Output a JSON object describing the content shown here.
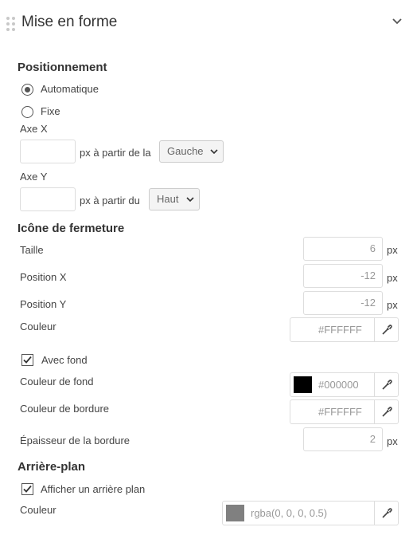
{
  "header": {
    "title": "Mise en forme"
  },
  "positionnement": {
    "title": "Positionnement",
    "option_auto": "Automatique",
    "option_fixe": "Fixe",
    "selected": "Automatique",
    "axe_x_label": "Axe X",
    "axe_x_value": "",
    "axe_x_suffix": "px à partir de la",
    "axe_x_select": "Gauche",
    "axe_y_label": "Axe Y",
    "axe_y_value": "",
    "axe_y_suffix": "px à partir du",
    "axe_y_select": "Haut"
  },
  "fermeture": {
    "title": "Icône de fermeture",
    "taille_label": "Taille",
    "taille_value": "6",
    "position_x_label": "Position X",
    "position_x_value": "-12",
    "position_y_label": "Position Y",
    "position_y_value": "-12",
    "unit": "px",
    "couleur_label": "Couleur",
    "couleur_value": "#FFFFFF",
    "avec_fond_label": "Avec fond",
    "avec_fond_checked": true,
    "couleur_fond_label": "Couleur de fond",
    "couleur_fond_value": "#000000",
    "couleur_bordure_label": "Couleur de bordure",
    "couleur_bordure_value": "#FFFFFF",
    "epaisseur_label": "Épaisseur de la bordure",
    "epaisseur_value": "2"
  },
  "arriere_plan": {
    "title": "Arrière-plan",
    "afficher_label": "Afficher un arrière plan",
    "afficher_checked": true,
    "couleur_label": "Couleur",
    "couleur_value": "rgba(0, 0, 0, 0.5)"
  },
  "colors": {
    "swatch_black": "#000000",
    "swatch_rgba": "#808080"
  }
}
